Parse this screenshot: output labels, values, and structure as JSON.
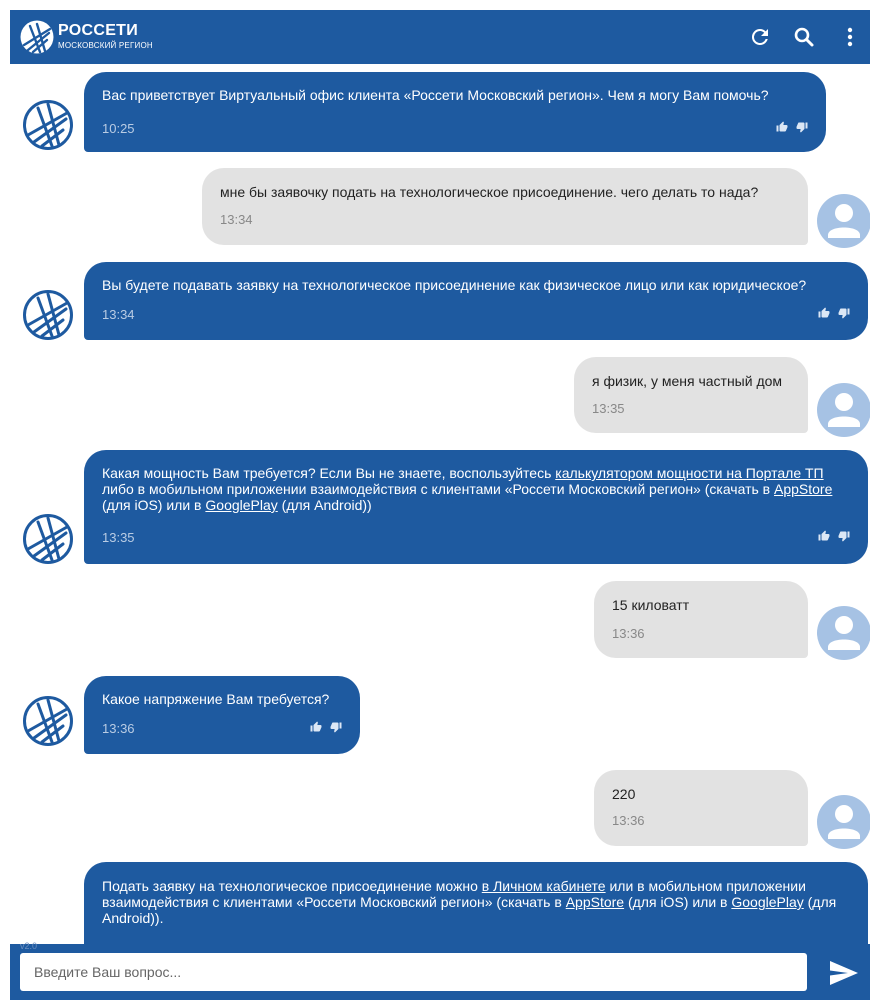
{
  "header": {
    "brand_name": "РОССЕТИ",
    "brand_region": "МОСКОВСКИЙ РЕГИОН",
    "refresh_icon": "refresh-icon",
    "search_icon": "search-icon",
    "menu_icon": "more-vertical-icon",
    "color": "#1e5aa0"
  },
  "messages": [
    {
      "from": "bot",
      "parts": [
        {
          "text": "Вас приветствует Виртуальный офис клиента «Россети Московский регион». Чем я могу Вам помочь?"
        }
      ],
      "time": "10:25"
    },
    {
      "from": "user",
      "text": "мне бы заявочку подать на технологическое присоединение. чего делать то нада?",
      "time": "13:34"
    },
    {
      "from": "bot",
      "parts": [
        {
          "text": "Вы будете подавать заявку на технологическое присоединение как физическое лицо или как юридическое?"
        }
      ],
      "time": "13:34"
    },
    {
      "from": "user",
      "text": "я физик, у меня частный дом",
      "time": "13:35"
    },
    {
      "from": "bot",
      "parts": [
        {
          "text": "Какая мощность Вам требуется? Если Вы не знаете, воспользуйтесь "
        },
        {
          "text": "калькулятором мощности на Портале ТП",
          "link": true
        },
        {
          "text": " либо в мобильном приложении взаимодействия с клиентами «Россети Московский регион» (скачать в "
        },
        {
          "text": "AppStore",
          "link": true
        },
        {
          "text": " (для iOS) или в "
        },
        {
          "text": "GooglePlay",
          "link": true
        },
        {
          "text": " (для Android))"
        }
      ],
      "time": "13:35"
    },
    {
      "from": "user",
      "text": "15 киловатт",
      "time": "13:36"
    },
    {
      "from": "bot",
      "parts": [
        {
          "text": "Какое напряжение Вам требуется?"
        }
      ],
      "time": "13:36"
    },
    {
      "from": "user",
      "text": "220",
      "time": "13:36"
    },
    {
      "from": "bot",
      "parts": [
        {
          "text": "Подать заявку на технологическое присоединение можно "
        },
        {
          "text": "в Личном кабинете",
          "link": true
        },
        {
          "text": " или в мобильном приложении взаимодействия с клиентами «Россети Московский регион» (скачать в "
        },
        {
          "text": "AppStore",
          "link": true
        },
        {
          "text": " (для iOS) или в "
        },
        {
          "text": "GooglePlay",
          "link": true
        },
        {
          "text": " (для Android))."
        }
      ],
      "time": ""
    }
  ],
  "footer": {
    "version": "v2.0",
    "input_placeholder": "Введите Ваш вопрос...",
    "input_value": "",
    "send_icon": "send-icon"
  }
}
